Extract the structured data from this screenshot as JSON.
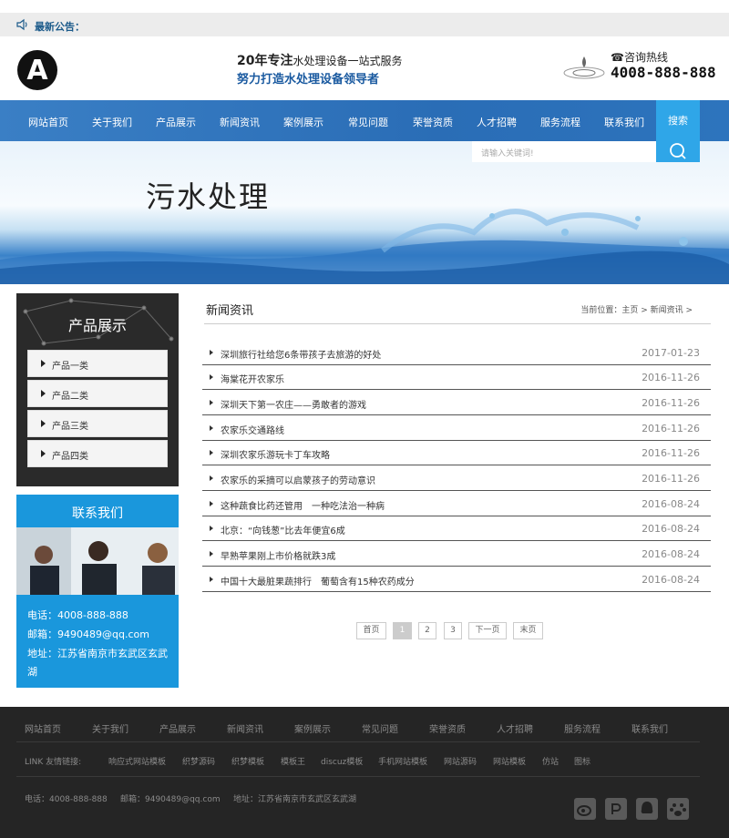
{
  "notice": {
    "label": "最新公告："
  },
  "header": {
    "logo_letter": "A",
    "slogan_bold": "20年专注",
    "slogan_rest": "水处理设备一站式服务",
    "slogan_sub": "努力打造水处理设备领导者",
    "hotline_label": "咨询热线",
    "hotline_number": "4008-888-888"
  },
  "nav": {
    "items": [
      "网站首页",
      "关于我们",
      "产品展示",
      "新闻资讯",
      "案例展示",
      "常见问题",
      "荣誉资质",
      "人才招聘",
      "服务流程",
      "联系我们"
    ],
    "search_tab": "搜索"
  },
  "search": {
    "placeholder": "请输入关键词!"
  },
  "banner": {
    "title": "污水处理"
  },
  "sidebar": {
    "category_title": "产品展示",
    "categories": [
      "产品一类",
      "产品二类",
      "产品三类",
      "产品四类"
    ],
    "contact_title": "联系我们",
    "phone": "电话：4008-888-888",
    "email": "邮箱：9490489@qq.com",
    "address_1": "地址：江苏省南京市玄武区玄武",
    "address_2": "湖"
  },
  "main": {
    "title": "新闻资讯",
    "breadcrumb": "当前位置：主页 > 新闻资讯 >",
    "news": [
      {
        "title": "深圳旅行社给您6条带孩子去旅游的好处",
        "date": "2017-01-23"
      },
      {
        "title": "海棠花开农家乐",
        "date": "2016-11-26"
      },
      {
        "title": "深圳天下第一农庄——勇敢者的游戏",
        "date": "2016-11-26"
      },
      {
        "title": "农家乐交通路线",
        "date": "2016-11-26"
      },
      {
        "title": "深圳农家乐游玩卡丁车攻略",
        "date": "2016-11-26"
      },
      {
        "title": "农家乐的采摘可以启蒙孩子的劳动意识",
        "date": "2016-11-26"
      },
      {
        "title": "这种蔬食比药还管用　一种吃法治一种病",
        "date": "2016-08-24"
      },
      {
        "title": "北京：“向钱葱”比去年便宜6成",
        "date": "2016-08-24"
      },
      {
        "title": "早熟苹果刚上市价格就跌3成",
        "date": "2016-08-24"
      },
      {
        "title": "中国十大最脏果蔬排行　葡萄含有15种农药成分",
        "date": "2016-08-24"
      }
    ],
    "pagination": {
      "first": "首页",
      "pages": [
        "1",
        "2",
        "3"
      ],
      "next": "下一页",
      "last": "末页"
    }
  },
  "footer": {
    "nav": [
      "网站首页",
      "关于我们",
      "产品展示",
      "新闻资讯",
      "案例展示",
      "常见问题",
      "荣誉资质",
      "人才招聘",
      "服务流程",
      "联系我们"
    ],
    "link_label": "LINK 友情链接:",
    "links": [
      "响应式网站模板",
      "织梦源码",
      "织梦模板",
      "模板王",
      "discuz模板",
      "手机网站模板",
      "网站源码",
      "网站模板",
      "仿站",
      "图标"
    ],
    "phone": "电话：4008-888-888",
    "email": "邮箱：9490489@qq.com",
    "address": "地址：江苏省南京市玄武区玄武湖",
    "social_icons": [
      "weibo-icon",
      "qzone-icon",
      "qq-icon",
      "baidu-icon"
    ]
  },
  "colors": {
    "nav_blue": "#2a6db6",
    "accent_blue": "#1a97dc",
    "footer_bg": "#252525",
    "sidebar_dark": "#2a2a2a"
  }
}
